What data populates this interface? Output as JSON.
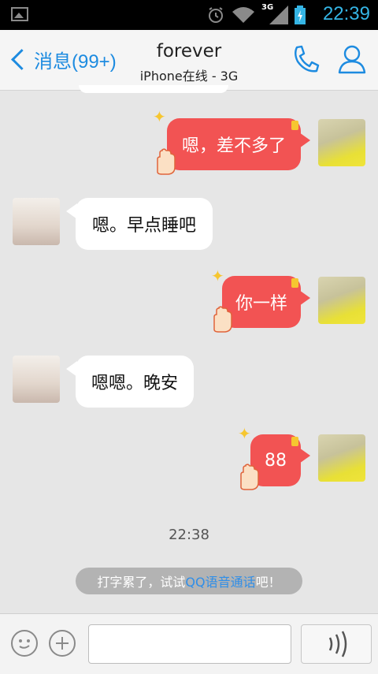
{
  "status_bar": {
    "time": "22:39",
    "network": "3G",
    "icons": [
      "image-icon",
      "alarm-icon",
      "wifi-icon",
      "signal-icon",
      "battery-icon"
    ]
  },
  "header": {
    "back_label": "消息(99+)",
    "contact_name": "forever",
    "contact_status": "iPhone在线 - 3G"
  },
  "messages": [
    {
      "from": "me",
      "text": "嗯，差不多了"
    },
    {
      "from": "her",
      "text": "嗯。早点睡吧"
    },
    {
      "from": "me",
      "text": "你一样"
    },
    {
      "from": "her",
      "text": "嗯嗯。晚安"
    },
    {
      "from": "me",
      "text": "88"
    }
  ],
  "timestamp": "22:38",
  "tip": {
    "prefix": "打字累了，试试",
    "link": "QQ语音通话",
    "suffix": "吧！"
  },
  "colors": {
    "accent": "#1d8be0",
    "bubble_me": "#f25353",
    "bubble_her": "#ffffff",
    "background": "#e6e6e6"
  }
}
